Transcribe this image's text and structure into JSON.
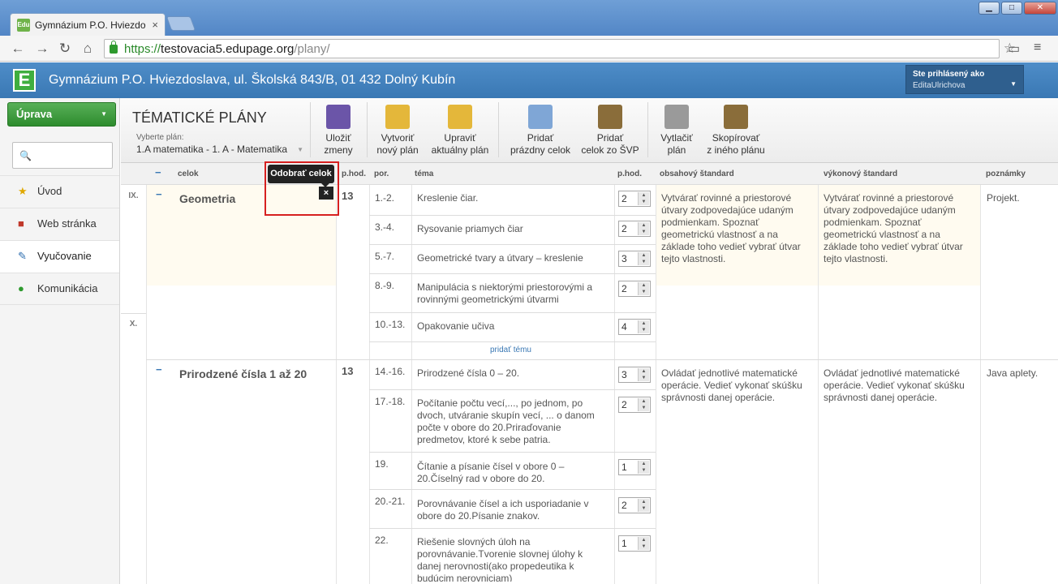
{
  "browser": {
    "tab_title": "Gymnázium P.O. Hviezdo",
    "favicon_text": "Edu",
    "url_scheme": "https://",
    "url_host": "testovacia5.edupage.org",
    "url_path": "/plany/"
  },
  "app": {
    "logo_letter": "E",
    "school_name": "Gymnázium P.O. Hviezdoslava, ul. Školská 843/B, 01 432 Dolný Kubín",
    "user_label": "Ste prihlásený ako",
    "user_name": "EditaUlrichova"
  },
  "sidebar": {
    "uprava": "Úprava",
    "items": [
      {
        "label": "Úvod"
      },
      {
        "label": "Web stránka"
      },
      {
        "label": "Vyučovanie"
      },
      {
        "label": "Komunikácia"
      }
    ]
  },
  "toolbar": {
    "title": "TÉMATICKÉ PLÁNY",
    "select_label": "Vyberte plán:",
    "select_value": "1.A matematika - 1. A - Matematika",
    "buttons": [
      {
        "l1": "Uložiť",
        "l2": "zmeny"
      },
      {
        "l1": "Vytvoriť",
        "l2": "nový plán"
      },
      {
        "l1": "Upraviť",
        "l2": "aktuálny plán"
      },
      {
        "l1": "Pridať",
        "l2": "prázdny celok"
      },
      {
        "l1": "Pridať",
        "l2": "celok zo ŠVP"
      },
      {
        "l1": "Vytlačiť",
        "l2": "plán"
      },
      {
        "l1": "Skopírovať",
        "l2": "z iného plánu"
      }
    ]
  },
  "table": {
    "headers": {
      "minus": "−",
      "celok": "celok",
      "phod": "p.hod.",
      "por": "por.",
      "tema": "téma",
      "phod2": "p.hod.",
      "obsah": "obsahový štandard",
      "vykon": "výkonový štandard",
      "pozn": "poznámky"
    },
    "months": [
      "IX.",
      "X."
    ],
    "tooltip": "Odobrať celok",
    "remove_x": "×",
    "add_tema": "pridať tému",
    "celky": [
      {
        "name": "Geometria",
        "hours": "13",
        "obsah": "Vytvárať rovinné a priestorové útvary zodpovedajúce udaným podmienkam.  Spoznať geometrickú vlastnosť a na základe toho vedieť vybrať útvar tejto vlastnosti.",
        "vykon": "Vytvárať rovinné a priestorové útvary zodpovedajúce udaným podmienkam.  Spoznať geometrickú vlastnosť a na základe toho vedieť vybrať útvar tejto vlastnosti.",
        "pozn": "Projekt.",
        "temy": [
          {
            "por": "1.-2.",
            "tema": "Kreslenie čiar.",
            "hod": "2"
          },
          {
            "por": "3.-4.",
            "tema": "Rysovanie priamych čiar",
            "hod": "2"
          },
          {
            "por": "5.-7.",
            "tema": "Geometrické tvary a útvary – kreslenie",
            "hod": "3"
          },
          {
            "por": "8.-9.",
            "tema": "Manipulácia s niektorými priestorovými a rovinnými geometrickými útvarmi",
            "hod": "2"
          },
          {
            "por": "10.-13.",
            "tema": "Opakovanie učiva",
            "hod": "4"
          }
        ]
      },
      {
        "name": "Prirodzené čísla 1 až 20",
        "hours": "13",
        "obsah": "Ovládať jednotlivé matematické operácie. Vedieť vykonať skúšku správnosti danej operácie.",
        "vykon": "Ovládať jednotlivé matematické operácie. Vedieť vykonať skúšku správnosti danej operácie.",
        "pozn": "Java aplety.",
        "temy": [
          {
            "por": "14.-16.",
            "tema": "Prirodzené čísla 0 – 20.",
            "hod": "3"
          },
          {
            "por": "17.-18.",
            "tema": "Počítanie počtu vecí,..., po jednom, po dvoch, utváranie skupín vecí, ... o danom počte v obore do 20.Priraďovanie predmetov, ktoré k sebe patria.",
            "hod": "2"
          },
          {
            "por": "19.",
            "tema": "Čítanie a písanie čísel v obore 0 – 20.Číselný rad v obore do 20.",
            "hod": "1"
          },
          {
            "por": "20.-21.",
            "tema": "Porovnávanie čísel a ich usporiadanie v obore do 20.Písanie znakov.",
            "hod": "2"
          },
          {
            "por": "22.",
            "tema": "Riešenie slovných úloh na porovnávanie.Tvorenie slovnej úlohy k danej nerovnosti(ako propedeutika k budúcim nerovniciam)",
            "hod": "1"
          }
        ]
      }
    ]
  }
}
